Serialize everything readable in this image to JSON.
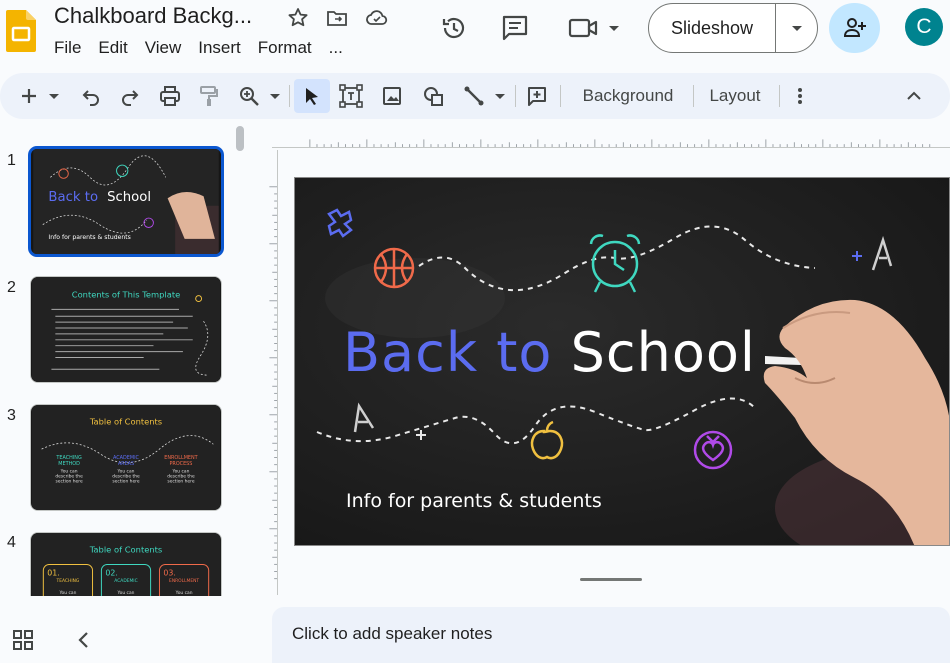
{
  "app": {
    "name": "Google Slides"
  },
  "doc": {
    "title": "Chalkboard Backg..."
  },
  "menu": {
    "items": [
      "File",
      "Edit",
      "View",
      "Insert",
      "Format",
      "..."
    ]
  },
  "header": {
    "slideshow_label": "Slideshow",
    "avatar_letter": "C"
  },
  "toolbar": {
    "background_label": "Background",
    "layout_label": "Layout"
  },
  "filmstrip": {
    "slides": [
      {
        "number": "1",
        "title": "Back to School",
        "subtitle": "Info for parents & students"
      },
      {
        "number": "2",
        "title": "Contents of This Template"
      },
      {
        "number": "3",
        "title": "Table of Contents",
        "items": [
          "TEACHING METHOD",
          "ACADEMIC AREAS",
          "ENROLLMENT PROCESS"
        ],
        "desc": "You can describe the section here"
      },
      {
        "number": "4",
        "title": "Table of Contents",
        "items": [
          "01.",
          "02.",
          "03."
        ],
        "labels": [
          "TEACHING METHOD",
          "ACADEMIC AREAS",
          "ENROLLMENT PROCESS"
        ],
        "desc": "You can describe the section here"
      }
    ]
  },
  "slide": {
    "title_part1": "Back to ",
    "title_part2": "School",
    "subtitle": "Info for parents & students"
  },
  "notes": {
    "placeholder": "Click to add speaker notes"
  },
  "colors": {
    "accent": "#0b57d0",
    "share_bg": "#c2e7ff",
    "avatar_bg": "#00838f",
    "toolbar_bg": "#edf2fa",
    "chalk_blue": "#5b6cf0"
  }
}
